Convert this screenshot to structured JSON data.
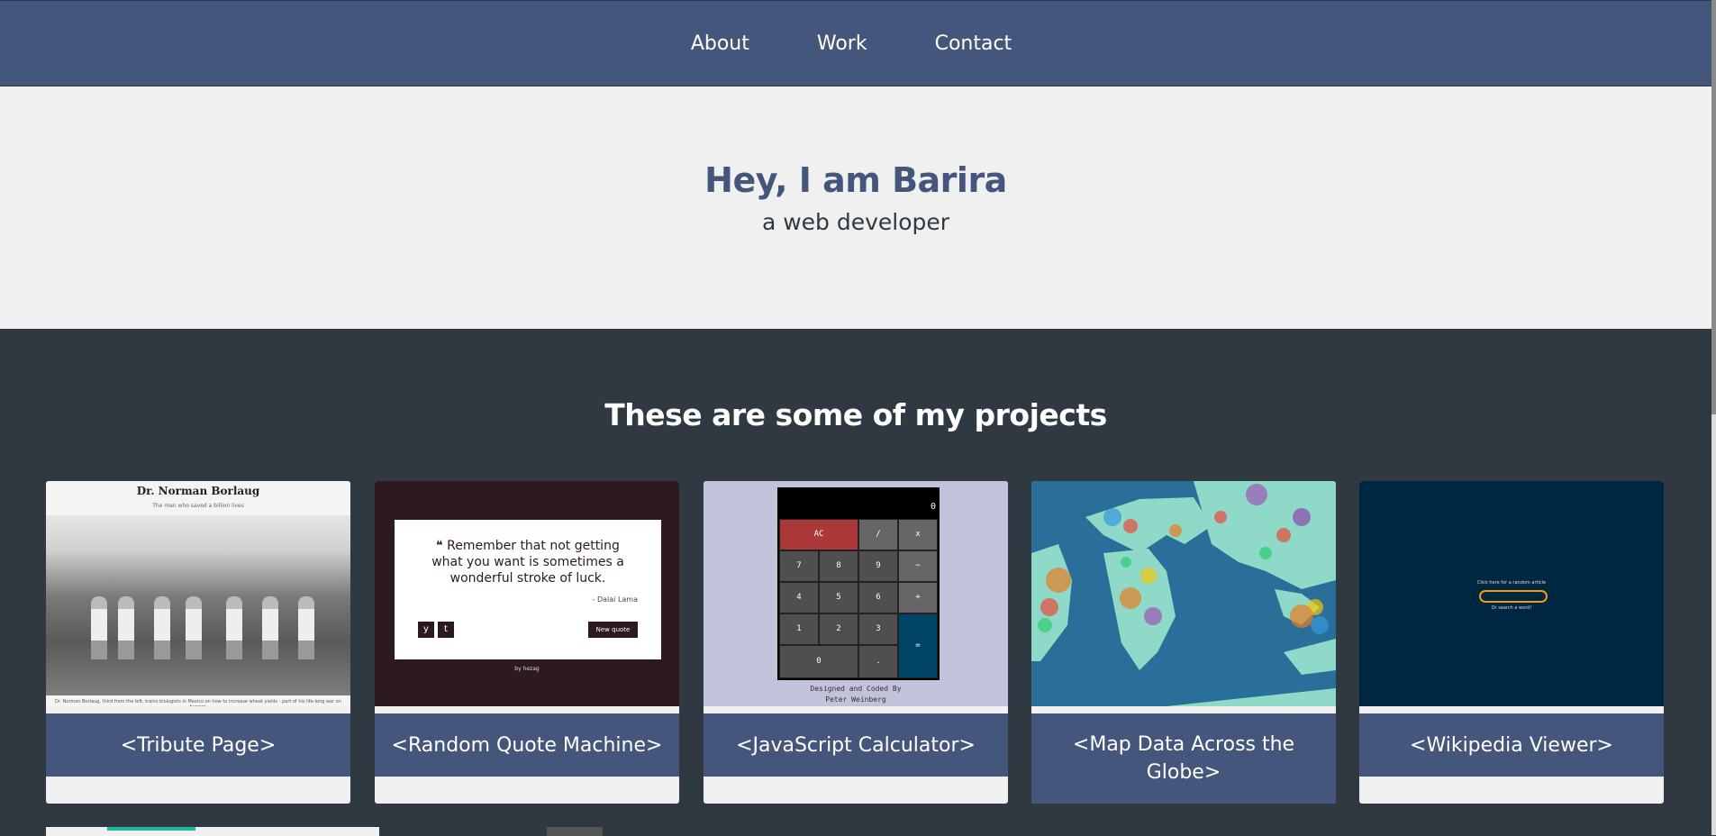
{
  "nav": {
    "links": [
      {
        "label": "About"
      },
      {
        "label": "Work"
      },
      {
        "label": "Contact"
      }
    ]
  },
  "welcome": {
    "title": "Hey, I am Barira",
    "subtitle": "a web developer"
  },
  "projects": {
    "heading": "These are some of my projects",
    "tiles": [
      {
        "title": "<Tribute Page>",
        "preview": {
          "heading": "Dr. Norman Borlaug",
          "subheading": "The man who saved a billion lives",
          "caption": "Dr. Norman Borlaug, third from the left, trains biologists in Mexico on how to increase wheat yields - part of his life-long war on hunger."
        }
      },
      {
        "title": "<Random Quote Machine>",
        "preview": {
          "quote": "Remember that not getting what you want is sometimes a wonderful stroke of luck.",
          "author": "- Dalai Lama",
          "twitter_glyph": "y",
          "tumblr_glyph": "t",
          "new_quote_label": "New quote",
          "byline": "by hezag"
        }
      },
      {
        "title": "<JavaScript Calculator>",
        "preview": {
          "display_value": "0",
          "keys": [
            "AC",
            "/",
            "x",
            "7",
            "8",
            "9",
            "−",
            "4",
            "5",
            "6",
            "+",
            "1",
            "2",
            "3",
            "=",
            "0",
            "."
          ],
          "credit_line1": "Designed and Coded By",
          "credit_line2": "Peter Weinberg"
        }
      },
      {
        "title": "<Map Data Across the Globe>",
        "preview": {}
      },
      {
        "title": "<Wikipedia Viewer>",
        "preview": {
          "line1": "Click here for a random article",
          "line2": "Or search a word!"
        }
      }
    ]
  },
  "colors": {
    "nav_bg": "#45567d",
    "welcome_bg": "#f0f0f0",
    "projects_bg": "#303841",
    "accent": "#45567d"
  }
}
